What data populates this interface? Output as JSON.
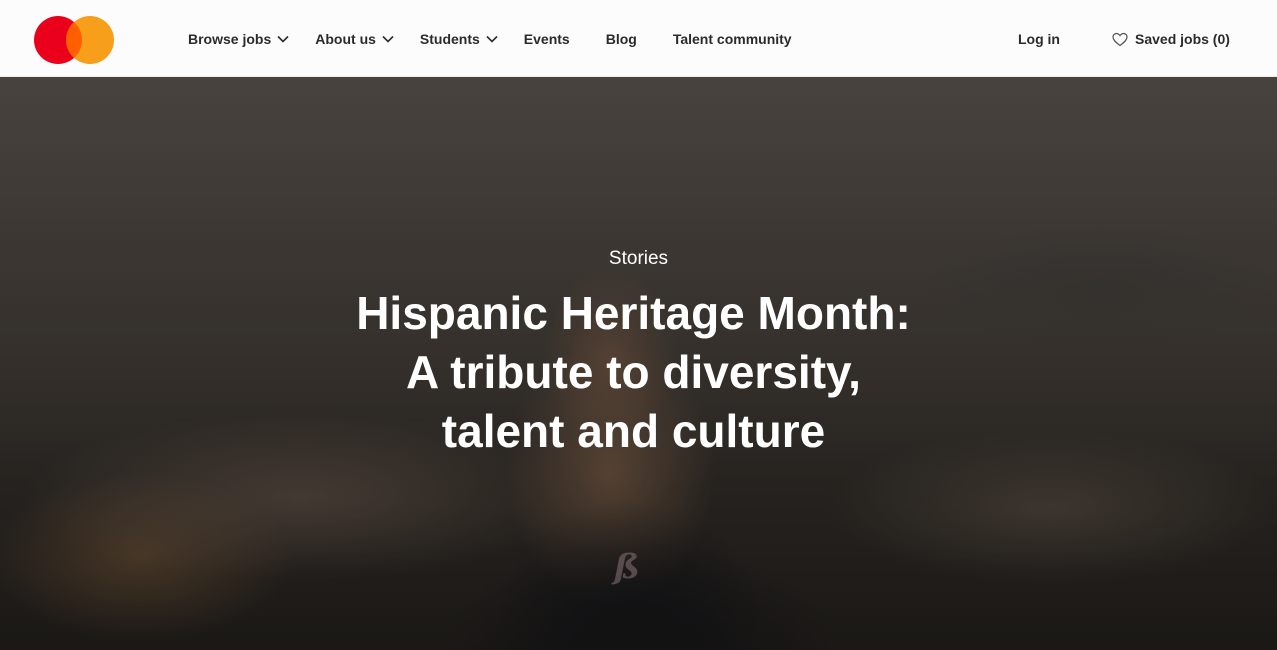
{
  "brand": {
    "name": "Mastercard",
    "colors": {
      "red": "#eb001b",
      "orange": "#f79e1b",
      "overlap": "#ff5f00"
    }
  },
  "nav": {
    "items": [
      {
        "label": "Browse jobs",
        "has_dropdown": true,
        "icon": "chevron-down-icon"
      },
      {
        "label": "About us",
        "has_dropdown": true,
        "icon": "chevron-down-icon"
      },
      {
        "label": "Students",
        "has_dropdown": true,
        "icon": "chevron-down-icon"
      },
      {
        "label": "Events",
        "has_dropdown": false
      },
      {
        "label": "Blog",
        "has_dropdown": false
      },
      {
        "label": "Talent community",
        "has_dropdown": false
      }
    ],
    "login_label": "Log in",
    "saved_jobs_label": "Saved jobs (0)",
    "saved_icon": "heart-outline-icon"
  },
  "hero": {
    "eyebrow": "Stories",
    "title_lines": [
      "Hispanic Heritage Month:",
      "A tribute to diversity,",
      "talent and culture"
    ]
  }
}
